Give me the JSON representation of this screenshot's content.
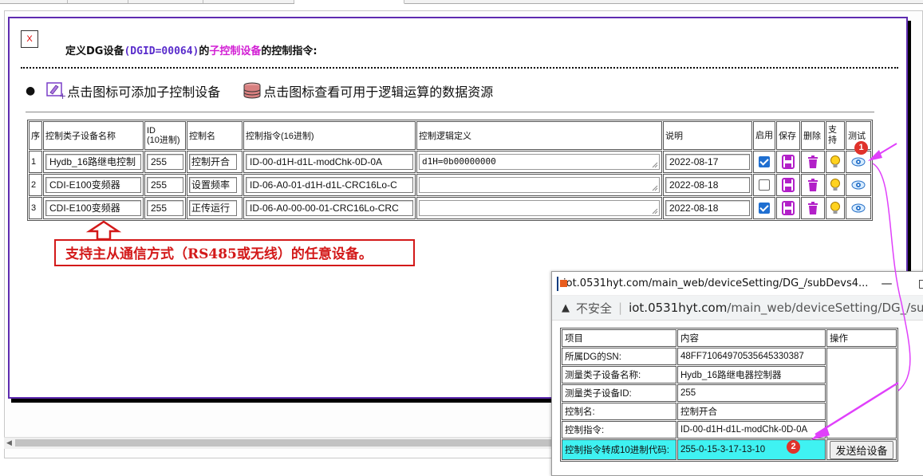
{
  "dialog": {
    "close_label": "X",
    "title_prefix": "定义DG设备",
    "title_gid": "(DGID=00064)",
    "title_mid": "的",
    "title_sub": "子控制设备",
    "title_suffix": "的控制指令:",
    "hint_add": "点击图标可添加子控制设备",
    "hint_view": "点击图标查看可用于逻辑运算的数据资源"
  },
  "table": {
    "headers": {
      "seq": "序",
      "name": "控制类子设备名称",
      "id": "ID\n(10进制)",
      "ctrl_name": "控制名",
      "cmd": "控制指令(16进制)",
      "logic": "控制逻辑定义",
      "desc": "说明",
      "enable": "启用",
      "save": "保存",
      "delete": "删除",
      "support": "支持",
      "test": "测试"
    },
    "rows": [
      {
        "seq": "1",
        "name": "Hydb_16路继电控制",
        "id": "255",
        "ctrl_name": "控制开合",
        "cmd": "ID-00-d1H-d1L-modChk-0D-0A",
        "logic": "d1H=0b00000000",
        "desc": "2022-08-17",
        "enabled": true
      },
      {
        "seq": "2",
        "name": "CDI-E100变频器",
        "id": "255",
        "ctrl_name": "设置频率",
        "cmd": "ID-06-A0-01-d1H-d1L-CRC16Lo-C",
        "logic": "",
        "desc": "2022-08-18",
        "enabled": false
      },
      {
        "seq": "3",
        "name": "CDI-E100变频器",
        "id": "255",
        "ctrl_name": "正传运行",
        "cmd": "ID-06-A0-00-00-01-CRC16Lo-CRC",
        "logic": "",
        "desc": "2022-08-18",
        "enabled": true
      }
    ]
  },
  "callout": "支持主从通信方式（RS485或无线）的任意设备。",
  "popup": {
    "window_title": "iot.0531hyt.com/main_web/deviceSetting/DG_/subDevs4...",
    "minimize": "—",
    "maximize": "□",
    "insecure_label": "不安全",
    "address_host": "iot.0531hyt.com",
    "address_path": "/main_web/deviceSetting/DG_/subDevs",
    "headers": {
      "item": "项目",
      "content": "内容",
      "op": "操作"
    },
    "rows": [
      {
        "label": "所属DG的SN:",
        "value": "48FF71064970535645330387"
      },
      {
        "label": "测量类子设备名称:",
        "value": "Hydb_16路继电器控制器"
      },
      {
        "label": "测量类子设备ID:",
        "value": "255"
      },
      {
        "label": "控制名:",
        "value": "控制开合"
      },
      {
        "label": "控制指令:",
        "value": "ID-00-d1H-d1L-modChk-0D-0A"
      },
      {
        "label": "控制指令转成10进制代码:",
        "value": "255-0-15-3-17-13-10"
      }
    ],
    "send_button": "发送给设备"
  },
  "badges": {
    "b1": "1",
    "b2": "2"
  },
  "colors": {
    "dialog_border": "#5e2bb0",
    "gid": "#5a2dcc",
    "sub_highlight": "#d21fd4",
    "callout": "#d31919",
    "arrow": "#e040fb",
    "cyan_row": "#3ff2f2",
    "checkbox": "#1f6fd1"
  },
  "icons": {
    "add": "add-device-icon",
    "db": "database-icon",
    "save": "save-icon",
    "delete": "trash-icon",
    "support": "lightbulb-icon",
    "test": "eye-icon"
  }
}
